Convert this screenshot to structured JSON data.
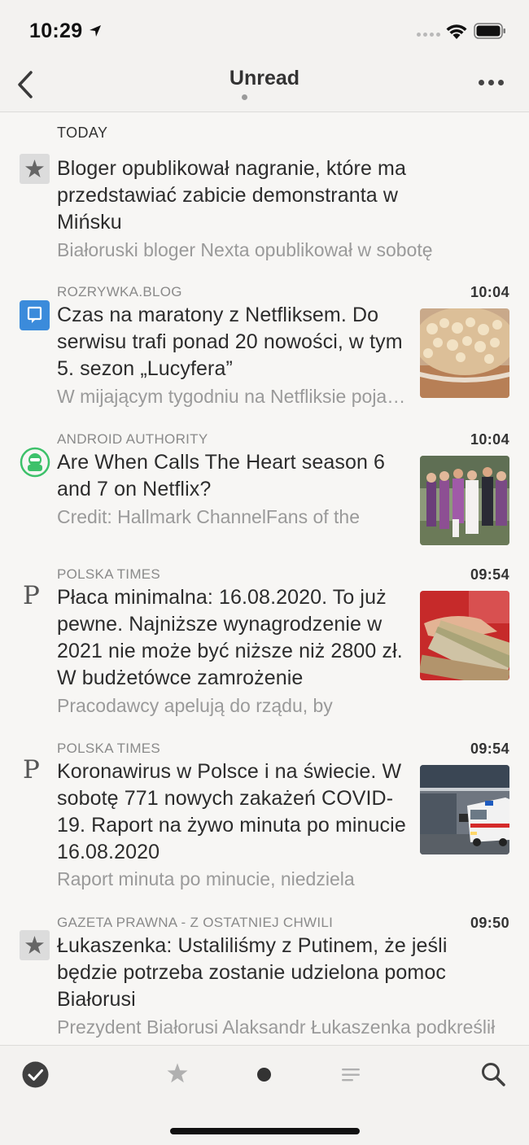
{
  "status_bar": {
    "time": "10:29"
  },
  "nav": {
    "title": "Unread"
  },
  "section": {
    "label": "TODAY"
  },
  "articles": [
    {
      "source": "",
      "time": "",
      "title": "Bloger opublikował nagranie, które ma przedstawiać zabicie demonstranta w Mińsku",
      "snippet": "Białoruski bloger Nexta opublikował w sobotę",
      "icon": "star-icon"
    },
    {
      "source": "ROZRYWKA.BLOG",
      "time": "10:04",
      "title": "Czas na maratony z Netfliksem. Do serwisu trafi ponad 20 nowości, w tym 5. sezon „Lucyfera”",
      "snippet": "W mijającym tygodniu na Netfliksie pojawiło się",
      "icon": "blog-icon"
    },
    {
      "source": "ANDROID AUTHORITY",
      "time": "10:04",
      "title": "Are When Calls The Heart season 6 and 7 on Netflix?",
      "snippet": "Credit: Hallmark ChannelFans of the",
      "icon": "android-authority-icon"
    },
    {
      "source": "POLSKA TIMES",
      "time": "09:54",
      "title": "Płaca minimalna: 16.08.2020. To już pewne. Najniższe wynagrodzenie w 2021 nie może być niższe niż 2800 zł. W budżetówce zamrożenie",
      "snippet": "Pracodawcy apelują do rządu, by",
      "icon": "polska-times-icon"
    },
    {
      "source": "POLSKA TIMES",
      "time": "09:54",
      "title": "Koronawirus w Polsce i na świecie. W sobotę 771 nowych zakażeń COVID-19. Raport na żywo minuta po minucie 16.08.2020",
      "snippet": "Raport minuta po minucie, niedziela",
      "icon": "polska-times-icon"
    },
    {
      "source": "GAZETA PRAWNA - Z OSTATNIEJ CHWILI",
      "time": "09:50",
      "title": "Łukaszenka: Ustaliliśmy z Putinem, że jeśli będzie potrzeba zostanie udzielona pomoc Białorusi",
      "snippet": "Prezydent Białorusi Alaksandr Łukaszenka podkreślił",
      "icon": "star-icon"
    }
  ],
  "tabs": [
    "mark-all-read-icon",
    "starred-icon",
    "unread-icon",
    "all-articles-icon",
    "search-icon"
  ]
}
